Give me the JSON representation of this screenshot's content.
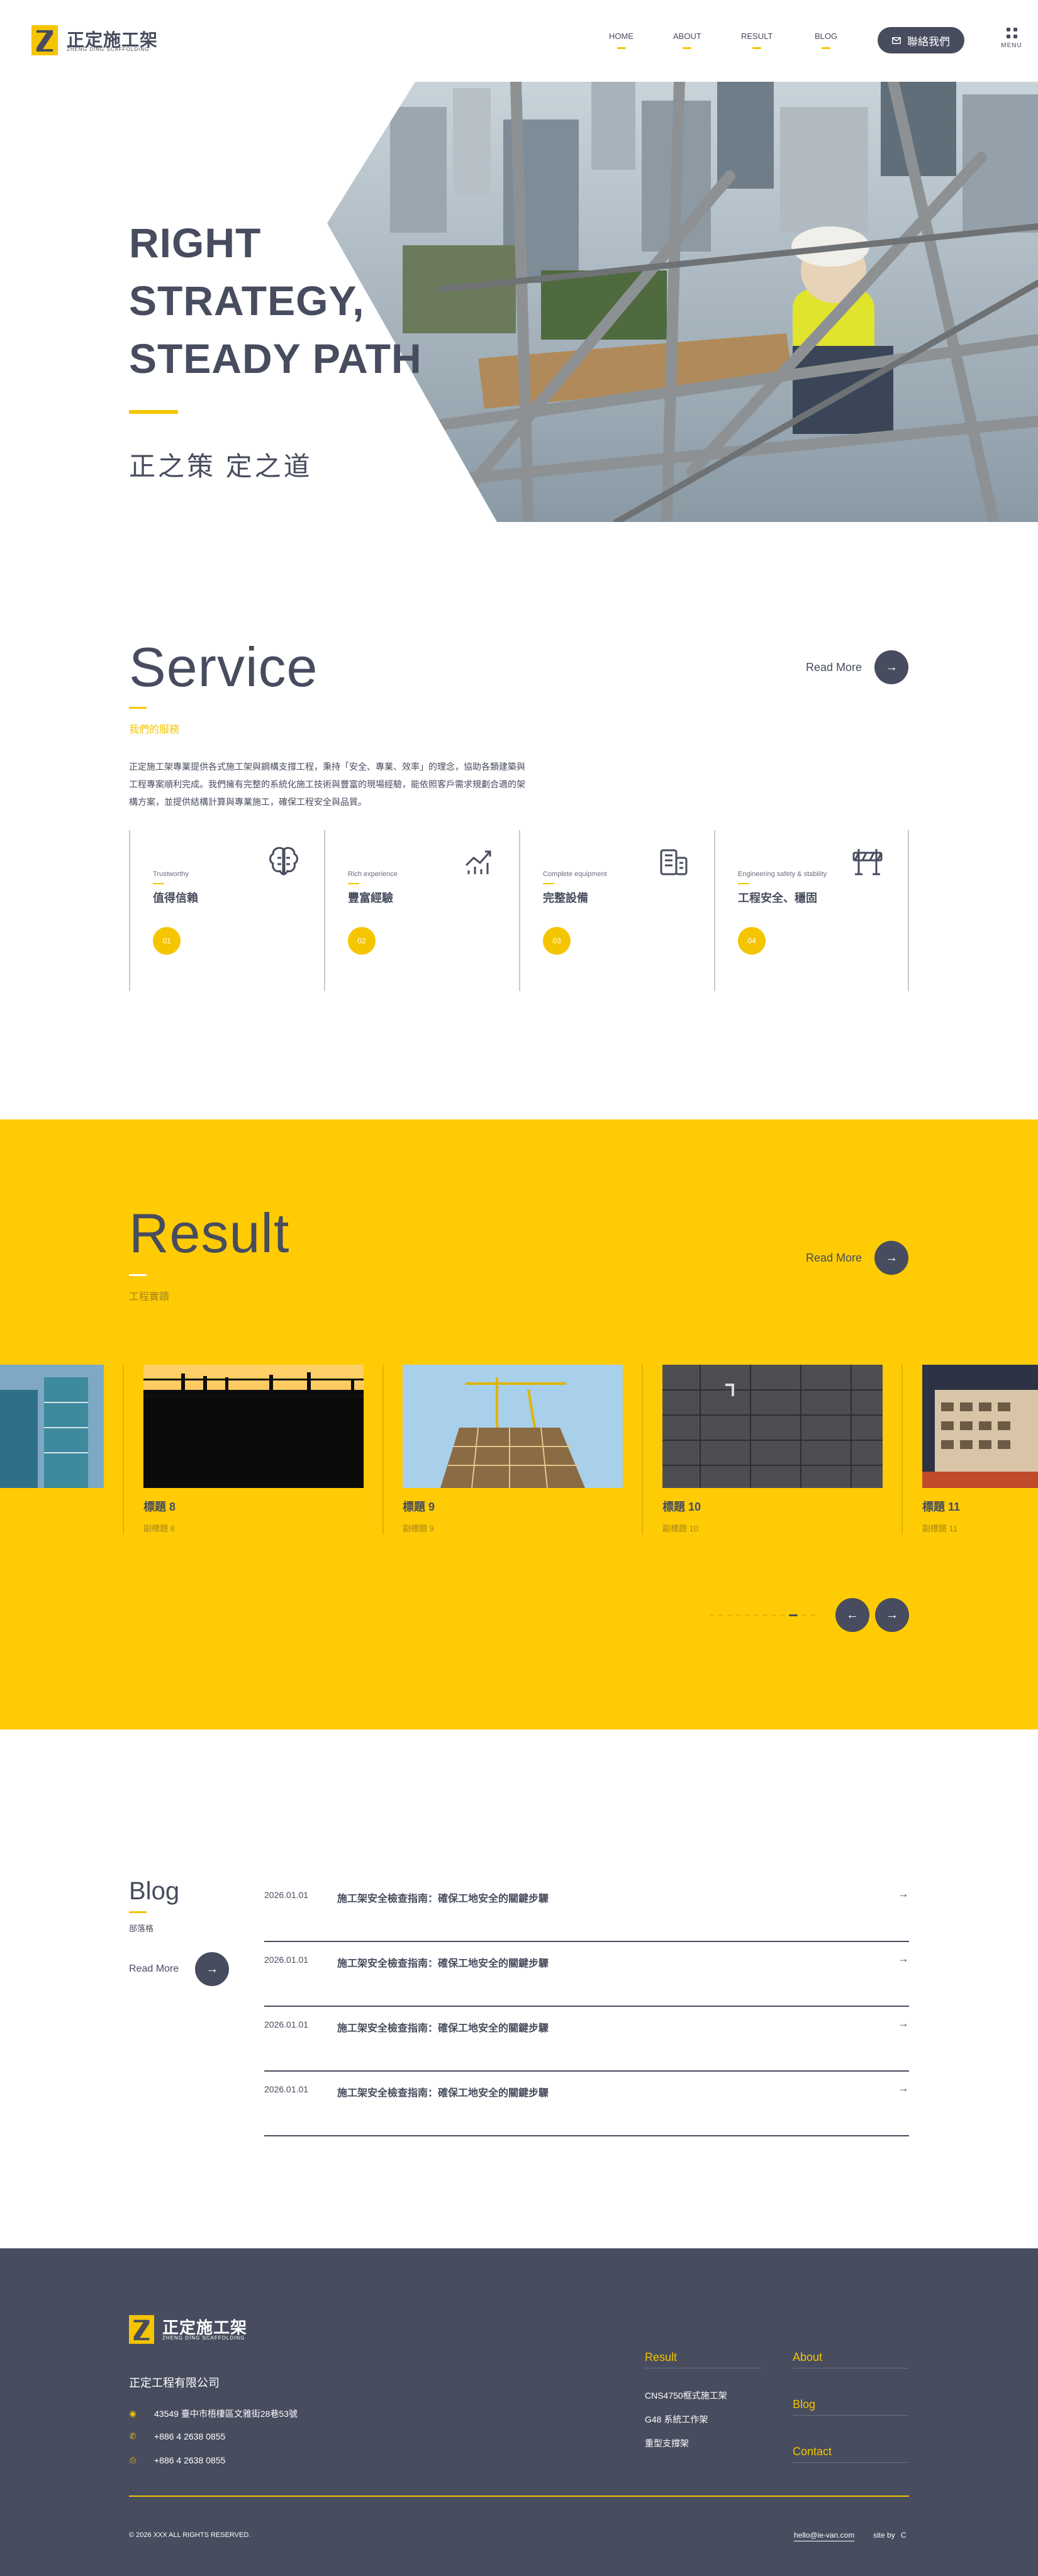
{
  "header": {
    "logo_name": "正定施工架",
    "logo_sub": "ZHENG DING SCAFFOLDING",
    "nav": [
      "HOME",
      "ABOUT",
      "RESULT",
      "BLOG"
    ],
    "contact_label": "聯絡我們",
    "menu_label": "MENU"
  },
  "hero": {
    "title_lines": [
      "RIGHT",
      "STRATEGY,",
      "STEADY PATH"
    ],
    "subtitle": "正之策 定之道"
  },
  "service": {
    "title": "Service",
    "subtitle": "我們的服務",
    "read_more": "Read More",
    "description": "正定施工架專業提供各式施工架與鋼構支撐工程，秉持「安全、專業、效率」的理念，協助各類建築與工程專案順利完成。我們擁有完整的系統化施工技術與豐富的現場經驗，能依照客戶需求規劃合適的架構方案，並提供結構計算與專業施工，確保工程安全與品質。",
    "cards": [
      {
        "en": "Trustworthy",
        "zh": "值得信賴",
        "num": "01",
        "icon": "brain-icon"
      },
      {
        "en": "Rich experience",
        "zh": "豐富經驗",
        "num": "02",
        "icon": "growth-chart-icon"
      },
      {
        "en": "Complete equipment",
        "zh": "完整設備",
        "num": "03",
        "icon": "building-icon"
      },
      {
        "en": "Engineering safety & stability",
        "zh": "工程安全、穩固",
        "num": "04",
        "icon": "barrier-icon"
      }
    ]
  },
  "result": {
    "title": "Result",
    "subtitle": "工程實蹟",
    "read_more": "Read More",
    "items": [
      {
        "title": "標題 8",
        "sub": "副標題 8"
      },
      {
        "title": "標題 9",
        "sub": "副標題 9"
      },
      {
        "title": "標題 10",
        "sub": "副標題 10"
      },
      {
        "title": "標題 11",
        "sub": "副標題 11"
      }
    ],
    "pager_total": 12,
    "pager_active": 9
  },
  "blog": {
    "title": "Blog",
    "subtitle": "部落格",
    "read_more": "Read More",
    "posts": [
      {
        "date": "2026.01.01",
        "title": "施工架安全檢查指南：確保工地安全的關鍵步驟"
      },
      {
        "date": "2026.01.01",
        "title": "施工架安全檢查指南：確保工地安全的關鍵步驟"
      },
      {
        "date": "2026.01.01",
        "title": "施工架安全檢查指南：確保工地安全的關鍵步驟"
      },
      {
        "date": "2026.01.01",
        "title": "施工架安全檢查指南：確保工地安全的關鍵步驟"
      }
    ]
  },
  "footer": {
    "logo_name": "正定施工架",
    "logo_sub": "ZHENG DING SCAFFOLDING",
    "company": "正定工程有限公司",
    "address": "43549 臺中市梧棲區文雅街28巷53號",
    "phone": "+886 4 2638 0855",
    "fax": "+886 4 2638 0855",
    "result_head": "Result",
    "result_links": [
      "CNS4750框式施工架",
      "G48 系統工作架",
      "重型支撐架"
    ],
    "about_head": "About",
    "blog_head": "Blog",
    "contact_head": "Contact",
    "copyright": "© 2026 XXX ALL RIGHTS RESERVED.",
    "email": "hello@ie-van.com",
    "site_by": "site by"
  },
  "colors": {
    "brand_yellow": "#ffcb05",
    "brand_slate": "#474c5e"
  }
}
